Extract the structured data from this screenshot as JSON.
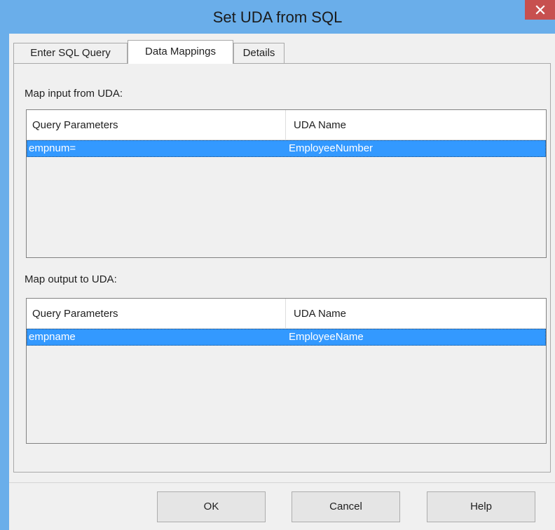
{
  "window": {
    "title": "Set UDA from SQL"
  },
  "tabs": [
    {
      "label": "Enter SQL Query",
      "active": false
    },
    {
      "label": "Data Mappings",
      "active": true
    },
    {
      "label": "Details",
      "active": false
    }
  ],
  "input_mapping": {
    "label": "Map input from UDA:",
    "columns": [
      "Query Parameters",
      "UDA Name"
    ],
    "rows": [
      {
        "parameter": "empnum=",
        "uda_name": "EmployeeNumber",
        "selected": true
      }
    ]
  },
  "output_mapping": {
    "label": "Map output to UDA:",
    "columns": [
      "Query Parameters",
      "UDA Name"
    ],
    "rows": [
      {
        "parameter": "empname",
        "uda_name": "EmployeeName",
        "selected": true
      }
    ]
  },
  "buttons": {
    "ok": "OK",
    "cancel": "Cancel",
    "help": "Help"
  },
  "icons": {
    "close": "close-icon"
  },
  "colors": {
    "titlebar": "#6aaeea",
    "close_button": "#c7504f",
    "selection": "#3399ff",
    "dialog_background": "#f0f0f0"
  }
}
